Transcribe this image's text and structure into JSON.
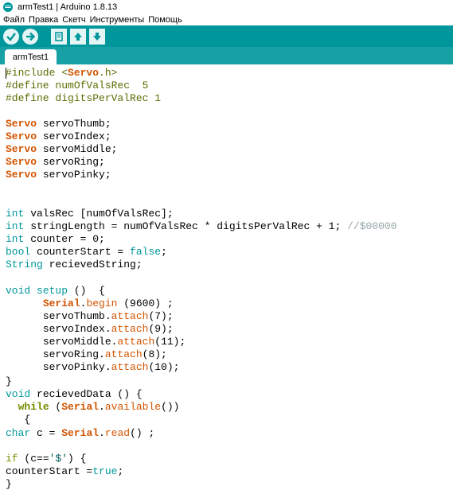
{
  "window": {
    "title": "armTest1 | Arduino 1.8.13"
  },
  "menu": [
    {
      "label": "Файл"
    },
    {
      "label": "Правка"
    },
    {
      "label": "Скетч"
    },
    {
      "label": "Инструменты"
    },
    {
      "label": "Помощь"
    }
  ],
  "toolbar": {
    "buttons": [
      {
        "icon": "verify-check-icon"
      },
      {
        "icon": "upload-arrow-icon"
      },
      {
        "icon": "new-file-icon"
      },
      {
        "icon": "open-arrow-up-icon"
      },
      {
        "icon": "save-arrow-down-icon"
      }
    ]
  },
  "tabs": [
    {
      "label": "armTest1",
      "active": true
    }
  ],
  "colors": {
    "toolbar": "#00979c",
    "tabstrip": "#17a1a5",
    "keyword_type": "#00979c",
    "keyword_class": "#d35400",
    "keyword_control": "#728e00"
  },
  "code": {
    "l1_a": "#include <",
    "l1_b": "Servo",
    "l1_c": ".h>",
    "l2": "#define numOfValsRec  5",
    "l3": "#define digitsPerValRec 1",
    "servo_kw": "Servo",
    "l5_b": " servoThumb;",
    "l6_b": " servoIndex;",
    "l7_b": " servoMiddle;",
    "l8_b": " servoRing;",
    "l9_b": " servoPinky;",
    "int_kw": "int",
    "l12_b": " valsRec [numOfValsRec];",
    "l13_b": " stringLength = numOfValsRec * digitsPerValRec + 1; ",
    "l13_c": "//$00000",
    "l14_b": " counter = 0;",
    "bool_kw": "bool",
    "l15_b": " counterStart = ",
    "false_kw": "false",
    "semi": ";",
    "string_kw": "String",
    "l16_b": " recievedString;",
    "void_kw": "void",
    "setup_kw": "setup",
    "l18_c": " ()  {",
    "indent6": "      ",
    "serial_kw": "Serial",
    "dot": ".",
    "begin_kw": "begin",
    "l19_c": " (9600) ;",
    "servo_thumb": "servoThumb",
    "servo_index": "servoIndex",
    "servo_middle": "servoMiddle",
    "servo_ring": "servoRing",
    "servo_pinky": "servoPinky",
    "attach_kw": "attach",
    "arg7": "(7);",
    "arg9": "(9);",
    "arg11": "(11);",
    "arg8": "(8);",
    "arg10": "(10);",
    "close_brace": "}",
    "l26_b": " recievedData () {",
    "indent2": "  ",
    "while_kw": "while",
    "l27_b": " (",
    "available_kw": "available",
    "l27_c": "())",
    "l28": "   {",
    "char_kw": "char",
    "l29_b": " c = ",
    "read_kw": "read",
    "l29_c": "() ;",
    "if_kw": "if",
    "l31_b": " (c==",
    "l31_str": "'$'",
    "l31_c": ") {",
    "l32_a": "counterStart =",
    "true_kw": "true",
    "l32_c": ";"
  }
}
